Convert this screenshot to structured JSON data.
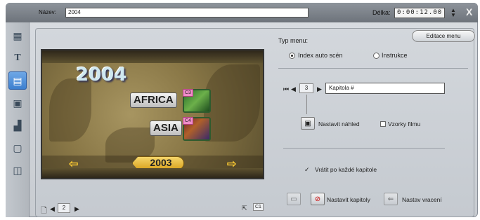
{
  "header": {
    "name_label": "Název:",
    "name_value": "2004",
    "duration_label": "Délka:",
    "duration_value": "0:00:12.00",
    "close_glyph": "X"
  },
  "toolbar": {
    "tools": [
      {
        "icon": "video-edit-icon",
        "glyph": "▦"
      },
      {
        "icon": "title-icon",
        "glyph": "T"
      },
      {
        "icon": "menu-icon",
        "glyph": "▤",
        "active": true
      },
      {
        "icon": "video-transition-icon",
        "glyph": "▣"
      },
      {
        "icon": "clapperboard-icon",
        "glyph": "▟"
      },
      {
        "icon": "disc-icon",
        "glyph": "▢"
      },
      {
        "icon": "connector-icon",
        "glyph": "◫"
      }
    ]
  },
  "preview": {
    "title": "2004",
    "buttons": [
      {
        "label": "AFRICA",
        "tag": "C3"
      },
      {
        "label": "ASIA",
        "tag": "C4"
      }
    ],
    "arrow_left": "⇦",
    "arrow_right": "⇨",
    "nav_year": "2003"
  },
  "page_nav": {
    "page_number": "2",
    "badge": "C1"
  },
  "menu_settings": {
    "edit_menu_button": "Editace menu",
    "menu_type_label": "Typ menu:",
    "radio_auto_label": "Index auto scén",
    "radio_instructions_label": "Instrukce",
    "selected": "auto"
  },
  "chapter": {
    "number": "3",
    "name": "Kapitola #",
    "set_preview_label": "Nastavit náhled",
    "film_samples_label": "Vzorky filmu",
    "return_after_label": "Vrátit po každé kapitole",
    "set_chapters_label": "Nastavit kapitoly",
    "set_return_label": "Nastav vracení"
  },
  "colors": {
    "accent": "#3d7fcf",
    "tag": "#f08cc8",
    "year_button": "#f1c232"
  }
}
